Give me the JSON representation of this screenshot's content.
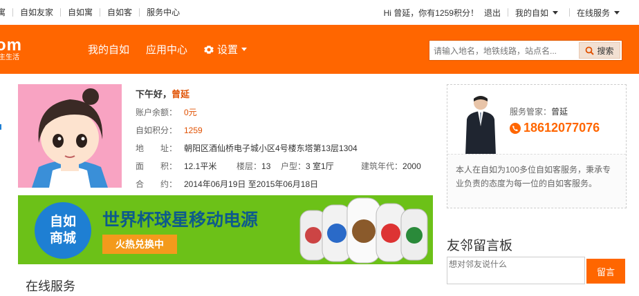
{
  "topbar": {
    "links": [
      "寓",
      "自如友家",
      "自如寓",
      "自如客",
      "服务中心"
    ],
    "greeting_prefix": "Hi 曾延，你有",
    "points": "1259",
    "greeting_suffix": "积分！",
    "logout": "退出",
    "my_ziroom": "我的自如",
    "online_service": "在线服务"
  },
  "nav": {
    "logo_big": "om",
    "logo_small": "主生活",
    "items": [
      "我的自如",
      "应用中心",
      "设置"
    ],
    "search_placeholder": "请输入地名，地铁线路，站点名...",
    "search_button": "搜索"
  },
  "profile": {
    "greeting": "下午好，",
    "name": "曾延",
    "balance_label": "账户余额：",
    "balance_value": "0元",
    "points_label": "自如积分：",
    "points_value": "1259",
    "address_label": "地　　址：",
    "address_value": "朝阳区酒仙桥电子城小区4号楼东塔第13层1304",
    "area_label": "面　　积：",
    "area_value": "12.1平米",
    "floor_label": "楼层：",
    "floor_value": "13",
    "layout_label": "户型：",
    "layout_value": "3 室1厅",
    "year_label": "建筑年代：",
    "year_value": "2000",
    "contract_label": "合　　约：",
    "contract_value": "2014年06月19日 至2015年06月18日"
  },
  "banner": {
    "circle_line1": "自如",
    "circle_line2": "商城",
    "title": "世界杯球星移动电源",
    "tag": "火热兑换中",
    "colors": {
      "bg": "#6cc118",
      "circle": "#1e7fd3",
      "tag": "#f39a1c"
    }
  },
  "section": {
    "online_service": "在线服务"
  },
  "manager": {
    "label": "服务管家：",
    "name": "曾延",
    "phone": "18612077076",
    "description": "本人在自如为100多位自如客服务，秉承专业负责的态度为每一位的自如客服务。"
  },
  "board": {
    "title": "友邻留言板",
    "placeholder": "想对邻友说什么",
    "button": "留言"
  },
  "colors": {
    "accent": "#ff6600"
  }
}
